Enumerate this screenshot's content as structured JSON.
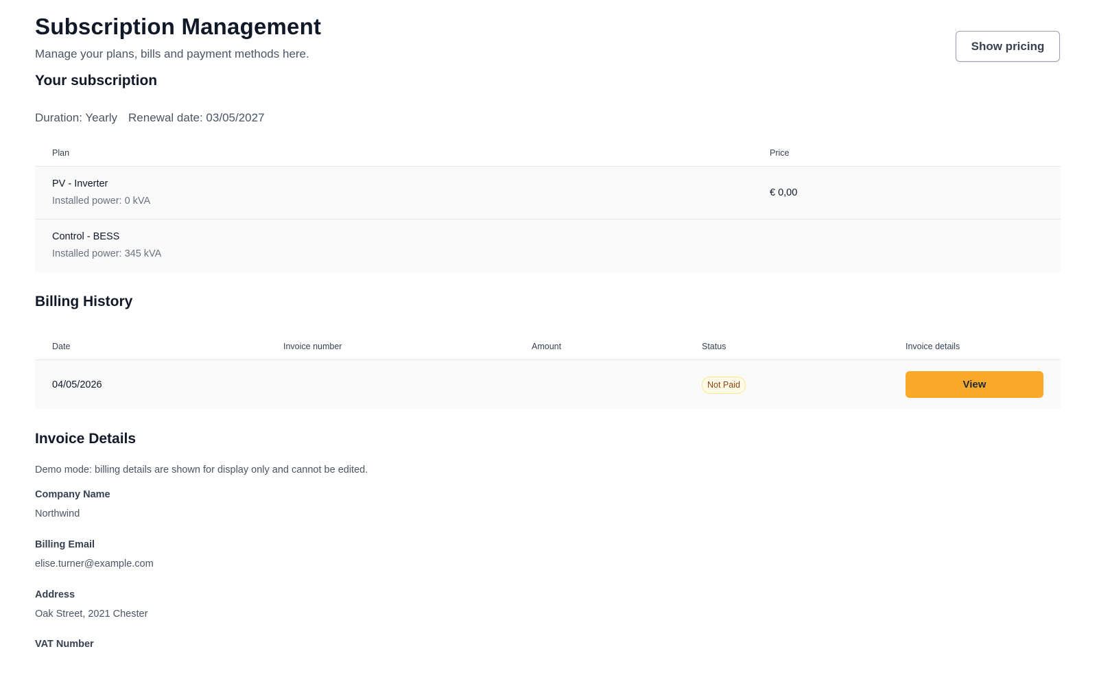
{
  "header": {
    "title": "Subscription Management",
    "subtitle": "Manage your plans, bills and payment methods here.",
    "pricing_button": "Show pricing"
  },
  "subscription": {
    "title": "Your subscription",
    "duration": "Duration: Yearly",
    "renewal": "Renewal date: 03/05/2027",
    "columns": {
      "plan": "Plan",
      "price": "Price"
    },
    "plans": [
      {
        "name": "PV - Inverter",
        "power": "Installed power: 0 kVA",
        "price": "€ 0,00"
      },
      {
        "name": "Control - BESS",
        "power": "Installed power: 345 kVA",
        "price": ""
      }
    ]
  },
  "billing": {
    "title": "Billing History",
    "columns": {
      "date": "Date",
      "invoice_number": "Invoice number",
      "amount": "Amount",
      "status": "Status",
      "details": "Invoice details"
    },
    "rows": [
      {
        "date": "04/05/2026",
        "invoice_number": "",
        "amount": "",
        "status": "Not Paid",
        "action": "View"
      }
    ]
  },
  "invoice_details": {
    "title": "Invoice Details",
    "note": "Demo mode: billing details are shown for display only and cannot be edited.",
    "fields": [
      {
        "label": "Company Name",
        "value": "Northwind"
      },
      {
        "label": "Billing Email",
        "value": "elise.turner@example.com"
      },
      {
        "label": "Address",
        "value": "Oak Street, 2021 Chester"
      },
      {
        "label": "VAT Number",
        "value": ""
      }
    ]
  },
  "colors": {
    "accent": "#fba92b",
    "status_badge_bg": "#fefce8",
    "status_badge_text": "#92400e"
  }
}
